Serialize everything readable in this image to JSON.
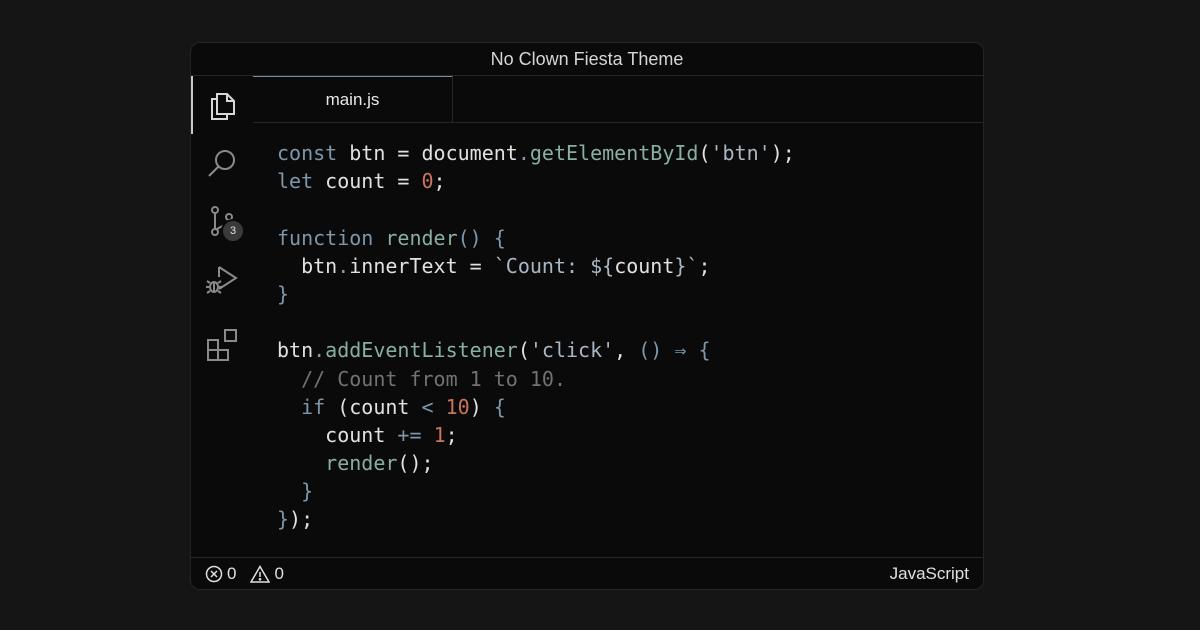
{
  "window": {
    "title": "No Clown Fiesta Theme"
  },
  "activity_bar": {
    "items": [
      {
        "icon": "files-icon",
        "active": true
      },
      {
        "icon": "search-icon",
        "active": false
      },
      {
        "icon": "source-control-icon",
        "active": false,
        "badge": "3"
      },
      {
        "icon": "run-debug-icon",
        "active": false
      },
      {
        "icon": "extensions-icon",
        "active": false
      }
    ]
  },
  "tabs": [
    {
      "label": "main.js",
      "active": true
    }
  ],
  "editor": {
    "language": "javascript",
    "lines": [
      [
        {
          "t": "const",
          "c": "kw"
        },
        {
          "t": " btn = document",
          "c": ""
        },
        {
          "t": ".",
          "c": "pn"
        },
        {
          "t": "getElementById",
          "c": "fn"
        },
        {
          "t": "(",
          "c": ""
        },
        {
          "t": "'btn'",
          "c": "str"
        },
        {
          "t": ");",
          "c": ""
        }
      ],
      [
        {
          "t": "let",
          "c": "kw"
        },
        {
          "t": " count = ",
          "c": ""
        },
        {
          "t": "0",
          "c": "num"
        },
        {
          "t": ";",
          "c": ""
        }
      ],
      [],
      [
        {
          "t": "function",
          "c": "kw"
        },
        {
          "t": " ",
          "c": ""
        },
        {
          "t": "render",
          "c": "fn"
        },
        {
          "t": "() {",
          "c": "pn"
        }
      ],
      [
        {
          "t": "  btn",
          "c": ""
        },
        {
          "t": ".",
          "c": "pn"
        },
        {
          "t": "innerText = ",
          "c": ""
        },
        {
          "t": "`Count: ${",
          "c": "str"
        },
        {
          "t": "count",
          "c": ""
        },
        {
          "t": "}`",
          "c": "str"
        },
        {
          "t": ";",
          "c": ""
        }
      ],
      [
        {
          "t": "}",
          "c": "pn"
        }
      ],
      [],
      [
        {
          "t": "btn",
          "c": ""
        },
        {
          "t": ".",
          "c": "pn"
        },
        {
          "t": "addEventListener",
          "c": "fn"
        },
        {
          "t": "(",
          "c": ""
        },
        {
          "t": "'click'",
          "c": "str"
        },
        {
          "t": ", ",
          "c": ""
        },
        {
          "t": "() ⇒ {",
          "c": "pn"
        }
      ],
      [
        {
          "t": "  // Count from 1 to 10.",
          "c": "cm"
        }
      ],
      [
        {
          "t": "  if",
          "c": "kw"
        },
        {
          "t": " (count ",
          "c": ""
        },
        {
          "t": "<",
          "c": "pn"
        },
        {
          "t": " ",
          "c": ""
        },
        {
          "t": "10",
          "c": "num"
        },
        {
          "t": ") ",
          "c": ""
        },
        {
          "t": "{",
          "c": "pn"
        }
      ],
      [
        {
          "t": "    count ",
          "c": ""
        },
        {
          "t": "+=",
          "c": "pn"
        },
        {
          "t": " ",
          "c": ""
        },
        {
          "t": "1",
          "c": "num"
        },
        {
          "t": ";",
          "c": ""
        }
      ],
      [
        {
          "t": "    ",
          "c": ""
        },
        {
          "t": "render",
          "c": "fn"
        },
        {
          "t": "();",
          "c": ""
        }
      ],
      [
        {
          "t": "  }",
          "c": "pn"
        }
      ],
      [
        {
          "t": "}",
          "c": "pn"
        },
        {
          "t": ");",
          "c": ""
        }
      ]
    ]
  },
  "status_bar": {
    "errors": "0",
    "warnings": "0",
    "language": "JavaScript"
  },
  "colors": {
    "background": "#151515",
    "editor_bg": "#0a0a0a",
    "keyword": "#7e97ab",
    "function": "#88afa2",
    "string": "#aab7c3",
    "number": "#cb7459",
    "comment": "#727272",
    "text": "#e1e1e1"
  }
}
